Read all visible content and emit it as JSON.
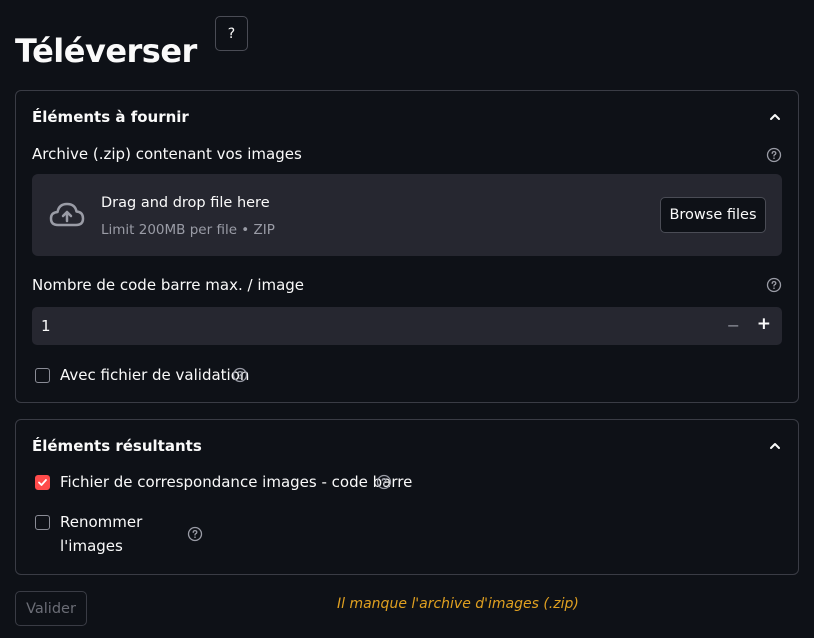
{
  "page": {
    "title": "Téléverser",
    "help_button": "?"
  },
  "inputs_section": {
    "title": "Éléments à fournir",
    "archive_label": "Archive (.zip) contenant vos images",
    "dropzone": {
      "main_text": "Drag and drop file here",
      "sub_text": "Limit 200MB per file • ZIP",
      "browse_label": "Browse files"
    },
    "barcode_label": "Nombre de code barre max. / image",
    "barcode_value": "1",
    "stepper": {
      "minus": "−",
      "plus": "+"
    },
    "validation_checkbox": {
      "label": "Avec fichier de validation",
      "checked": false
    }
  },
  "outputs_section": {
    "title": "Éléments résultants",
    "mapping_checkbox": {
      "label": "Fichier de correspondance images - code barre",
      "checked": true
    },
    "rename_checkbox": {
      "label_line1": "Renommer",
      "label_line2": "l'images",
      "checked": false
    }
  },
  "footer": {
    "validate_label": "Valider",
    "warning": "Il manque l'archive d'images (.zip)"
  },
  "colors": {
    "accent": "#ff4b4b",
    "warning": "#e0a020",
    "background": "#0e1117",
    "input_bg": "#262730"
  }
}
